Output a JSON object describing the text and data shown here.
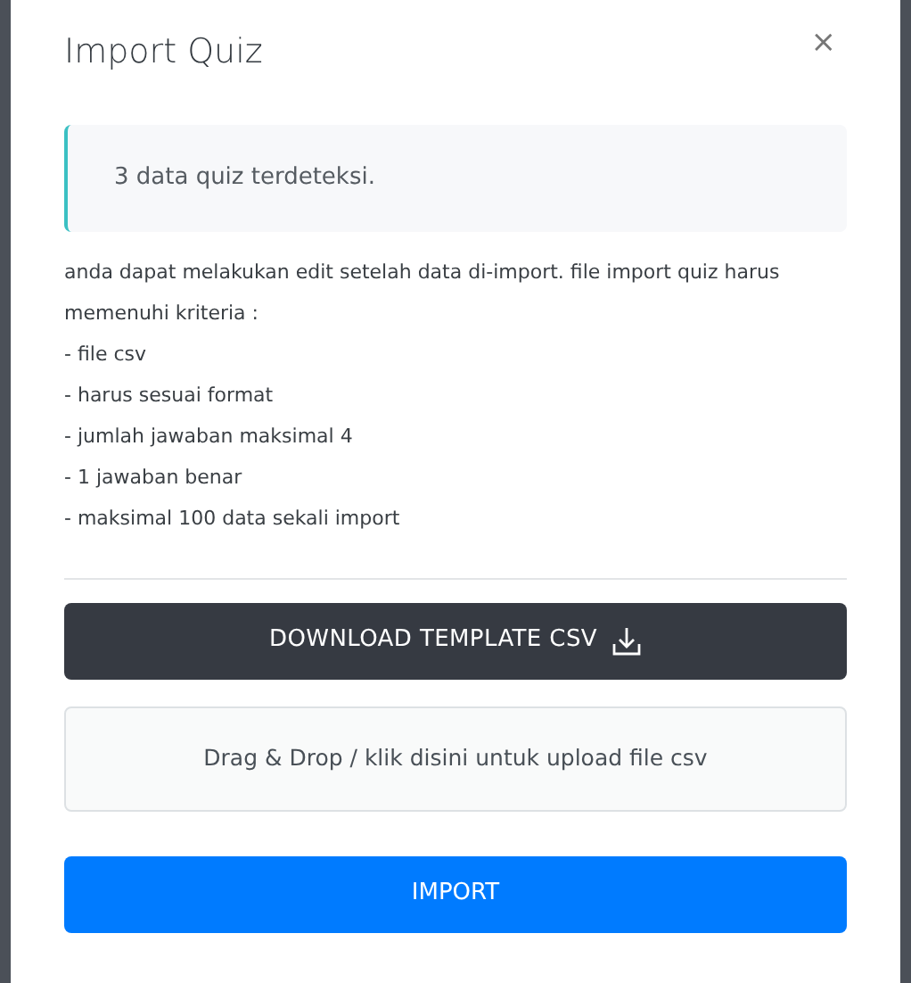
{
  "modal": {
    "title": "Import Quiz",
    "close": "×"
  },
  "alert": {
    "text": "3 data quiz terdeteksi."
  },
  "description": [
    "anda dapat melakukan edit setelah data di-import. file import quiz harus memenuhi kriteria :",
    "- file csv",
    "- harus sesuai format",
    "- jumlah jawaban maksimal 4",
    "- 1 jawaban benar",
    "- maksimal 100 data sekali import"
  ],
  "download_button": {
    "label": "DOWNLOAD TEMPLATE CSV"
  },
  "dropzone": {
    "text": "Drag & Drop / klik disini untuk upload file csv"
  },
  "import_button": {
    "label": "IMPORT"
  }
}
